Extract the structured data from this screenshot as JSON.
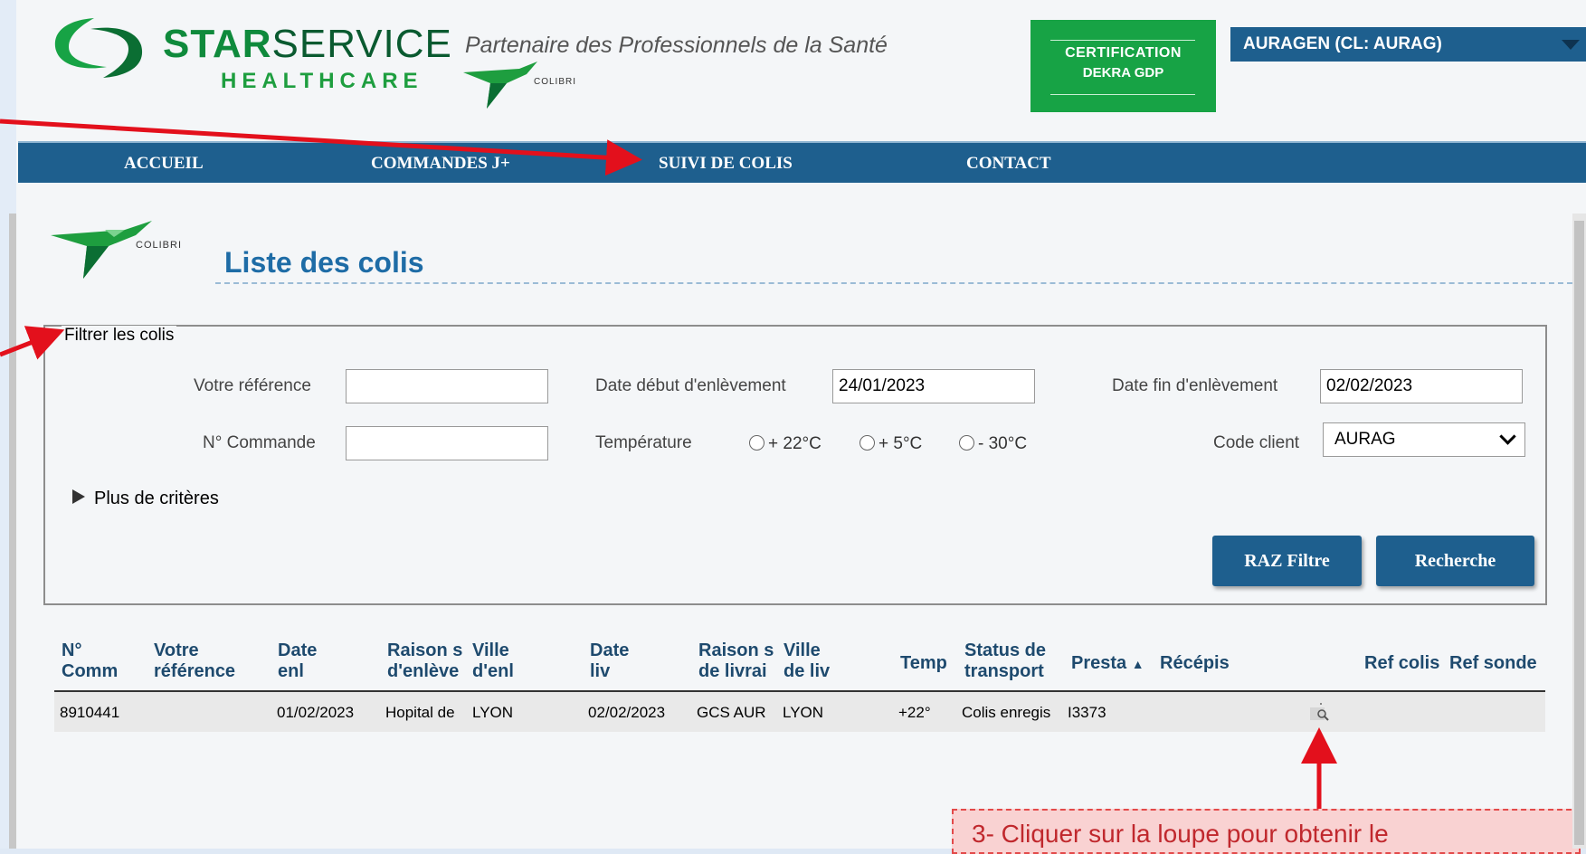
{
  "header": {
    "brand_strong": "STAR",
    "brand_light": "SERVICE",
    "brand_sub": "HEALTHCARE",
    "tagline": "Partenaire des Professionnels de la Santé",
    "colibri_small": "COLIBRI",
    "certification_line1": "CERTIFICATION",
    "certification_line2": "DEKRA GDP",
    "client_selector": "AURAGEN (CL: AURAG)"
  },
  "nav": {
    "items": [
      "ACCUEIL",
      "COMMANDES J+",
      "SUIVI DE COLIS",
      "CONTACT"
    ]
  },
  "page": {
    "colibri": "COLIBRI",
    "title": "Liste des colis"
  },
  "filter": {
    "legend": "Filtrer les colis",
    "ref_label": "Votre référence",
    "ref_value": "",
    "order_label": "N° Commande",
    "order_value": "",
    "start_label": "Date début d'enlèvement",
    "start_value": "24/01/2023",
    "end_label": "Date fin d'enlèvement",
    "end_value": "02/02/2023",
    "temp_label": "Température",
    "temp_options": [
      "+ 22°C",
      "+ 5°C",
      "- 30°C"
    ],
    "client_label": "Code client",
    "client_value": "AURAG",
    "more_label": "Plus de critères",
    "reset_button": "RAZ Filtre",
    "search_button": "Recherche"
  },
  "table": {
    "columns": [
      [
        "N°",
        "Comm"
      ],
      [
        "Votre",
        "référence"
      ],
      [
        "Date",
        "enl"
      ],
      [
        "Raison s",
        "d'enlève"
      ],
      [
        "Ville",
        "d'enl"
      ],
      [
        "Date",
        "liv"
      ],
      [
        "Raison s",
        "de livrai"
      ],
      [
        "Ville",
        "de liv"
      ],
      [
        "Temp"
      ],
      [
        "Status de",
        "transport"
      ],
      [
        "Presta"
      ],
      [
        "Récépis"
      ],
      [
        "Ref colis"
      ],
      [
        "Ref sonde"
      ]
    ],
    "rows": [
      [
        "8910441",
        "",
        "01/02/2023",
        "Hopital de",
        "LYON",
        "02/02/2023",
        "GCS AUR",
        "LYON",
        "+22°",
        "Colis enregis",
        "I3373",
        "",
        "",
        ""
      ]
    ]
  },
  "annotation": {
    "note": "3- Cliquer sur la loupe pour obtenir le",
    "color": "#e3101c"
  },
  "colors": {
    "nav": "#1e5f8e",
    "brand_green": "#17a345",
    "title_blue": "#1e6ca6"
  }
}
